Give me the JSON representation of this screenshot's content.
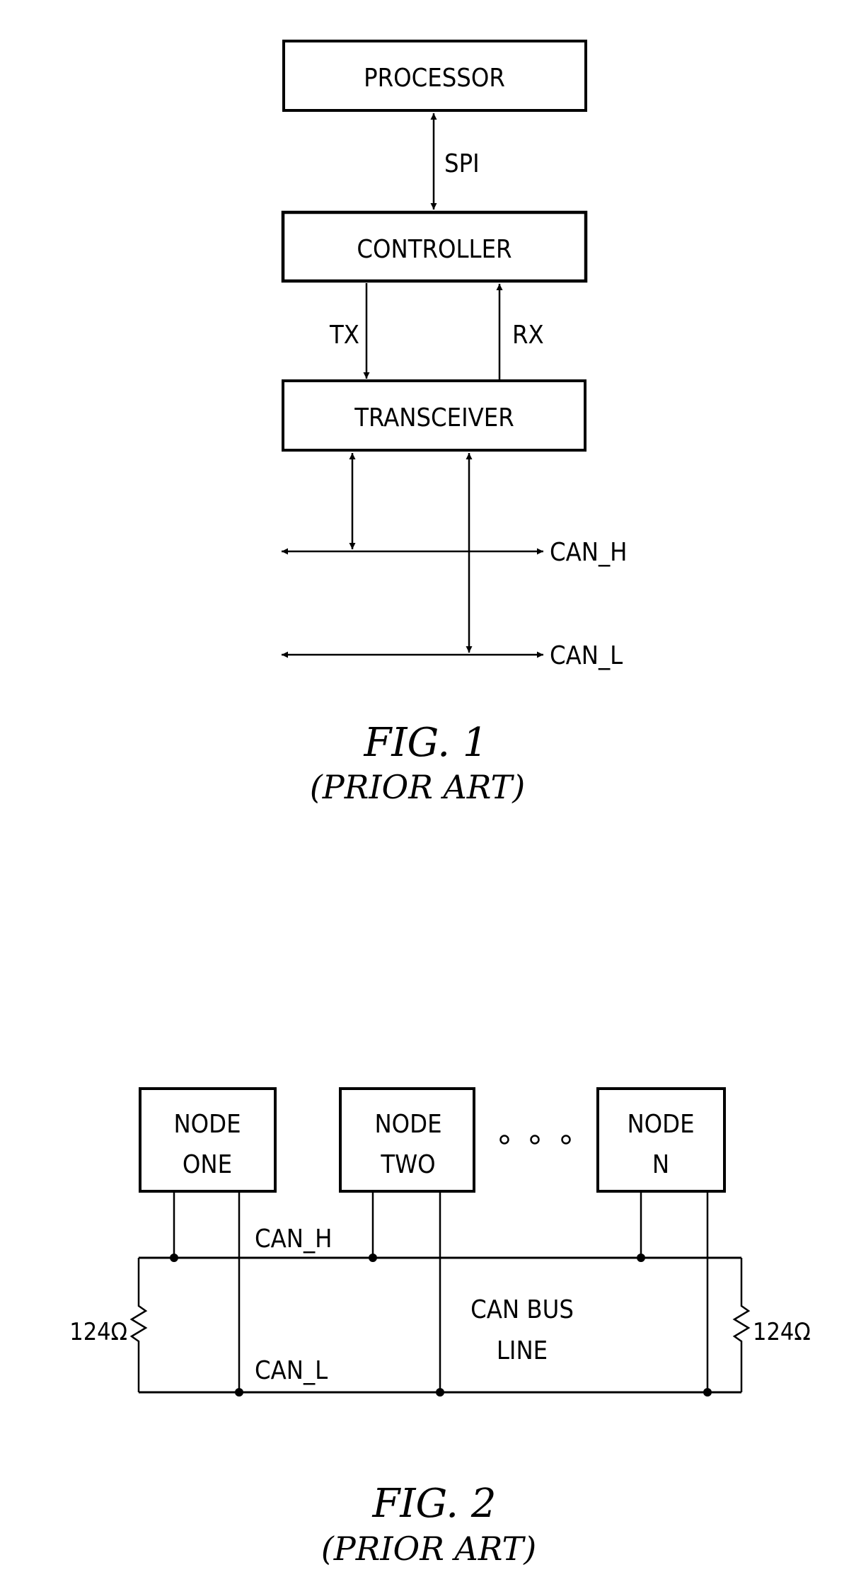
{
  "figure1": {
    "blocks": {
      "processor": "PROCESSOR",
      "controller": "CONTROLLER",
      "transceiver": "TRANSCEIVER"
    },
    "signals": {
      "spi": "SPI",
      "tx": "TX",
      "rx": "RX"
    },
    "bus_lines": {
      "can_h": "CAN_H",
      "can_l": "CAN_L"
    },
    "caption": {
      "title": "FIG. 1",
      "subtitle": "(PRIOR ART)"
    }
  },
  "figure2": {
    "nodes": [
      {
        "line1": "NODE",
        "line2": "ONE"
      },
      {
        "line1": "NODE",
        "line2": "TWO"
      },
      {
        "line1": "NODE",
        "line2": "N"
      }
    ],
    "ellipsis_count": 3,
    "bus_labels": {
      "can_h": "CAN_H",
      "can_l": "CAN_L",
      "bus_line1": "CAN BUS",
      "bus_line2": "LINE"
    },
    "terminators": {
      "left": "124Ω",
      "right": "124Ω"
    },
    "caption": {
      "title": "FIG. 2",
      "subtitle": "(PRIOR ART)"
    }
  }
}
